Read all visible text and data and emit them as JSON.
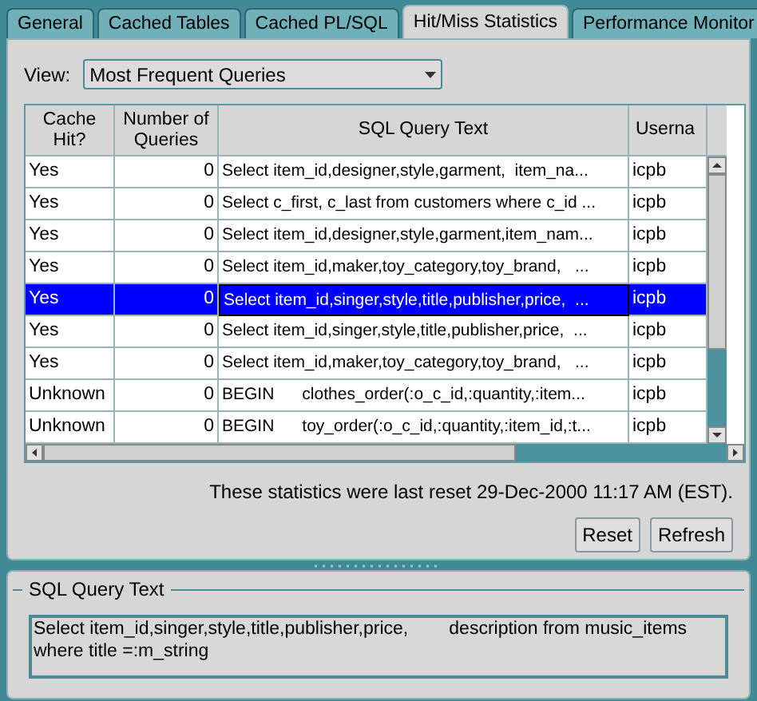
{
  "tabs": [
    {
      "label": "General",
      "selected": false
    },
    {
      "label": "Cached Tables",
      "selected": false
    },
    {
      "label": "Cached PL/SQL",
      "selected": false
    },
    {
      "label": "Hit/Miss Statistics",
      "selected": true
    },
    {
      "label": "Performance Monitor",
      "selected": false
    }
  ],
  "view": {
    "label": "View:",
    "value": "Most Frequent Queries"
  },
  "table": {
    "columns": [
      "Cache Hit?",
      "Number of Queries",
      "SQL Query Text",
      "Userna"
    ],
    "rows": [
      {
        "cells": [
          "Yes",
          "0",
          "Select item_id,designer,style,garment,  item_na...",
          "icpb"
        ],
        "selected": false
      },
      {
        "cells": [
          "Yes",
          "0",
          "Select c_first, c_last from customers where c_id ...",
          "icpb"
        ],
        "selected": false
      },
      {
        "cells": [
          "Yes",
          "0",
          "Select item_id,designer,style,garment,item_nam...",
          "icpb"
        ],
        "selected": false
      },
      {
        "cells": [
          "Yes",
          "0",
          "Select item_id,maker,toy_category,toy_brand,   ...",
          "icpb"
        ],
        "selected": false
      },
      {
        "cells": [
          "Yes",
          "0",
          "Select item_id,singer,style,title,publisher,price,  ...",
          "icpb"
        ],
        "selected": true
      },
      {
        "cells": [
          "Yes",
          "0",
          "Select item_id,singer,style,title,publisher,price,  ...",
          "icpb"
        ],
        "selected": false
      },
      {
        "cells": [
          "Yes",
          "0",
          "Select item_id,maker,toy_category,toy_brand,   ...",
          "icpb"
        ],
        "selected": false
      },
      {
        "cells": [
          "Unknown",
          "0",
          "BEGIN      clothes_order(:o_c_id,:quantity,:item...",
          "icpb"
        ],
        "selected": false
      },
      {
        "cells": [
          "Unknown",
          "0",
          "BEGIN      toy_order(:o_c_id,:quantity,:item_id,:t...",
          "icpb"
        ],
        "selected": false
      }
    ]
  },
  "reset_note": "These statistics were last reset 29-Dec-2000 11:17 AM (EST).",
  "buttons": [
    "Reset",
    "Refresh"
  ],
  "detail": {
    "title": "SQL Query Text",
    "text": "Select item_id,singer,style,title,publisher,price,        description from music_items\nwhere title =:m_string"
  }
}
